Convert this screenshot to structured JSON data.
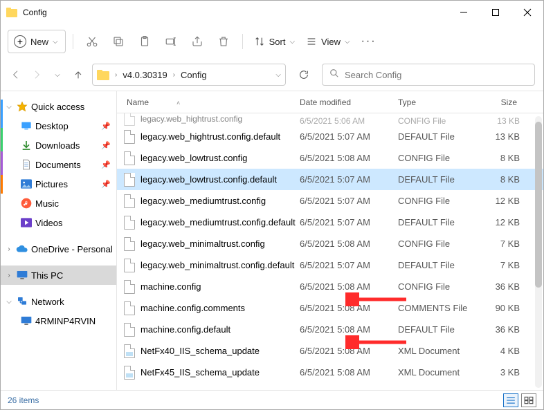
{
  "window": {
    "title": "Config"
  },
  "toolbar": {
    "new_label": "New",
    "sort_label": "Sort",
    "view_label": "View"
  },
  "address": {
    "crumbs": [
      "v4.0.30319",
      "Config"
    ]
  },
  "search": {
    "placeholder": "Search Config"
  },
  "columns": {
    "name": "Name",
    "date": "Date modified",
    "type": "Type",
    "size": "Size"
  },
  "sidebar": {
    "quick_access": "Quick access",
    "items": [
      {
        "label": "Desktop",
        "pin": true
      },
      {
        "label": "Downloads",
        "pin": true
      },
      {
        "label": "Documents",
        "pin": true
      },
      {
        "label": "Pictures",
        "pin": true
      },
      {
        "label": "Music",
        "pin": false
      },
      {
        "label": "Videos",
        "pin": false
      }
    ],
    "onedrive": "OneDrive - Personal",
    "this_pc": "This PC",
    "network": "Network",
    "network_items": [
      {
        "label": "4RMINP4RVIN"
      }
    ]
  },
  "files": [
    {
      "name": "legacy.web_hightrust.config",
      "date": "6/5/2021 5:06 AM",
      "type": "CONFIG File",
      "size": "13 KB",
      "partial": true
    },
    {
      "name": "legacy.web_hightrust.config.default",
      "date": "6/5/2021 5:07 AM",
      "type": "DEFAULT File",
      "size": "13 KB"
    },
    {
      "name": "legacy.web_lowtrust.config",
      "date": "6/5/2021 5:08 AM",
      "type": "CONFIG File",
      "size": "8 KB"
    },
    {
      "name": "legacy.web_lowtrust.config.default",
      "date": "6/5/2021 5:07 AM",
      "type": "DEFAULT File",
      "size": "8 KB",
      "selected": true
    },
    {
      "name": "legacy.web_mediumtrust.config",
      "date": "6/5/2021 5:07 AM",
      "type": "CONFIG File",
      "size": "12 KB"
    },
    {
      "name": "legacy.web_mediumtrust.config.default",
      "date": "6/5/2021 5:07 AM",
      "type": "DEFAULT File",
      "size": "12 KB"
    },
    {
      "name": "legacy.web_minimaltrust.config",
      "date": "6/5/2021 5:08 AM",
      "type": "CONFIG File",
      "size": "7 KB"
    },
    {
      "name": "legacy.web_minimaltrust.config.default",
      "date": "6/5/2021 5:07 AM",
      "type": "DEFAULT File",
      "size": "7 KB"
    },
    {
      "name": "machine.config",
      "date": "6/5/2021 5:08 AM",
      "type": "CONFIG File",
      "size": "36 KB",
      "arrow": true
    },
    {
      "name": "machine.config.comments",
      "date": "6/5/2021 5:08 AM",
      "type": "COMMENTS File",
      "size": "90 KB"
    },
    {
      "name": "machine.config.default",
      "date": "6/5/2021 5:08 AM",
      "type": "DEFAULT File",
      "size": "36 KB",
      "arrow": true
    },
    {
      "name": "NetFx40_IIS_schema_update",
      "date": "6/5/2021 5:08 AM",
      "type": "XML Document",
      "size": "4 KB",
      "xml": true
    },
    {
      "name": "NetFx45_IIS_schema_update",
      "date": "6/5/2021 5:08 AM",
      "type": "XML Document",
      "size": "3 KB",
      "xml": true
    }
  ],
  "status": {
    "count": "26 items"
  }
}
